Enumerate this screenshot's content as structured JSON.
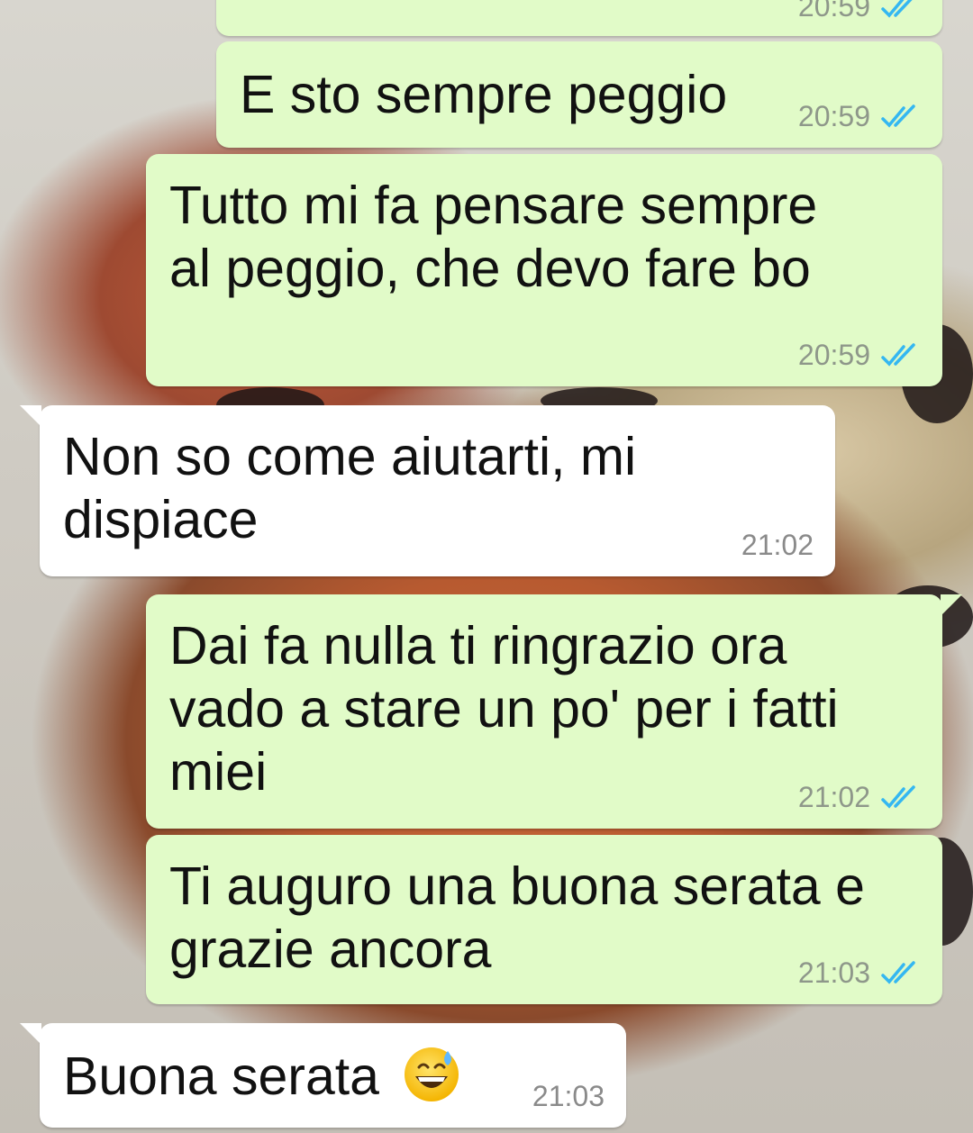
{
  "chat": {
    "messages": [
      {
        "direction": "out",
        "text": "",
        "time": "20:59",
        "status": "read"
      },
      {
        "direction": "out",
        "text": "E sto sempre peggio",
        "time": "20:59",
        "status": "read"
      },
      {
        "direction": "out",
        "text": "Tutto mi fa pensare sempre\nal peggio, che devo fare bo",
        "time": "20:59",
        "status": "read"
      },
      {
        "direction": "in",
        "text": "Non so come aiutarti, mi\ndispiace",
        "time": "21:02"
      },
      {
        "direction": "out",
        "text": "Dai fa nulla ti ringrazio ora\nvado a stare un po' per i fatti\nmiei",
        "time": "21:02",
        "status": "read"
      },
      {
        "direction": "out",
        "text": "Ti auguro una buona serata e\ngrazie ancora",
        "time": "21:03",
        "status": "read"
      },
      {
        "direction": "in",
        "text": "Buona serata ",
        "emoji": "grinning-face-with-sweat",
        "time": "21:03"
      }
    ]
  },
  "icons": {
    "read_receipt": "double-check-icon",
    "read_color": "#34b7f1"
  },
  "colors": {
    "outgoing_bubble": "#e1fbc8",
    "incoming_bubble": "#ffffff"
  }
}
